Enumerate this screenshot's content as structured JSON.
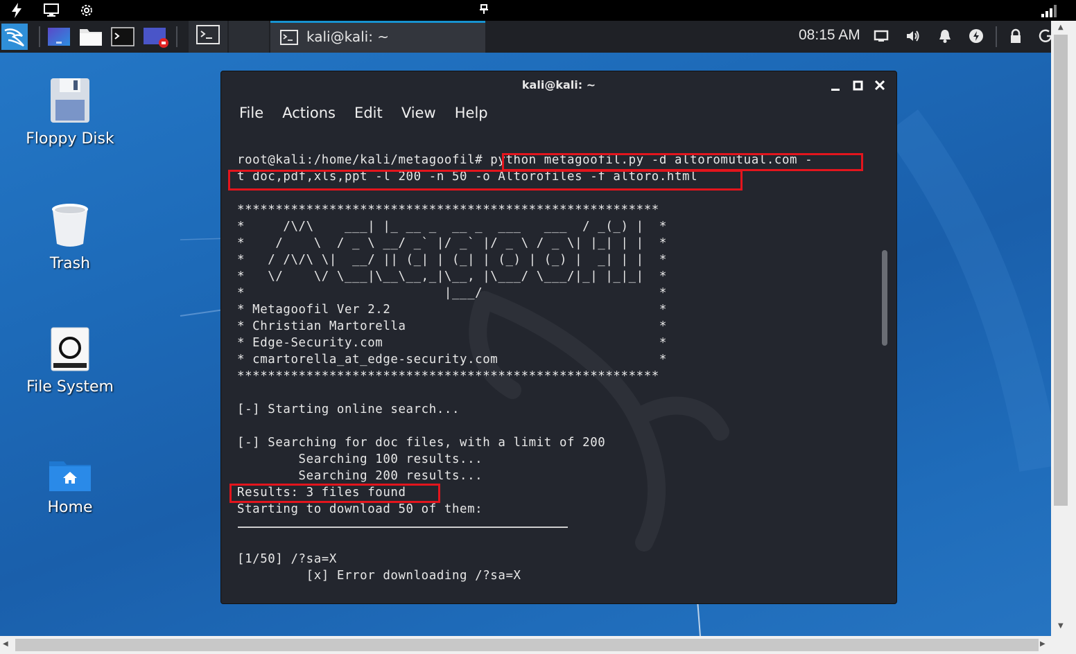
{
  "host_bar": {
    "icons": [
      "lightning-icon",
      "monitor-icon",
      "settings-gear-icon",
      "pin-icon",
      "signal-icon"
    ]
  },
  "panel": {
    "launchers": [
      "kali-menu",
      "show-desktop",
      "file-manager",
      "terminal",
      "screen-recorder"
    ],
    "task_label": "kali@kali: ~",
    "clock": "08:15 AM",
    "tray_icons": [
      "display-icon",
      "volume-icon",
      "bell-icon",
      "power-icon",
      "lock-icon",
      "refresh-icon"
    ]
  },
  "desktop": {
    "icons": [
      {
        "label": "Floppy Disk"
      },
      {
        "label": "Trash"
      },
      {
        "label": "File System"
      },
      {
        "label": "Home"
      }
    ]
  },
  "terminal": {
    "title": "kali@kali: ~",
    "menu": [
      "File",
      "Actions",
      "Edit",
      "View",
      "Help"
    ],
    "lines": {
      "prompt": "root@kali:/home/kali/metagoofil# python metagoofil.py -d altoromutual.com -",
      "cmd_cont": "t doc,pdf,xls,ppt -l 200 -n 50 -o Altorofiles -f altoro.html",
      "stars_top": "*******************************************************",
      "art1": "*     /\\/\\    ___| |_ __ _  __ _  ___   ___  / _(_) |  *",
      "art2": "*    /    \\  / _ \\ __/ _` |/ _` |/ _ \\ / _ \\| |_| | |  *",
      "art3": "*   / /\\/\\ \\|  __/ || (_| | (_| | (_) | (_) |  _| | |  *",
      "art4": "*   \\/    \\/ \\___|\\__\\__,_|\\__, |\\___/ \\___/|_| |_|_|  *",
      "art5": "*                          |___/                       *",
      "ver": "* Metagoofil Ver 2.2                                   *",
      "author": "* Christian Martorella                                 *",
      "site": "* Edge-Security.com                                    *",
      "mail": "* cmartorella_at_edge-security.com                     *",
      "stars_bottom": "*******************************************************",
      "start": "[-] Starting online search...",
      "searching": "[-] Searching for doc files, with a limit of 200",
      "s100": "        Searching 100 results...",
      "s200": "        Searching 200 results...",
      "results": "Results: 3 files found",
      "download": "Starting to download 50 of them:",
      "item": "[1/50] /?sa=X",
      "error": "         [x] Error downloading /?sa=X"
    }
  },
  "colors": {
    "highlight_box": "#e3151d",
    "panel_bg": "#1f2126",
    "terminal_bg": "#23262e",
    "desktop_blue": "#1d6ab8",
    "accent": "#1793d1"
  }
}
